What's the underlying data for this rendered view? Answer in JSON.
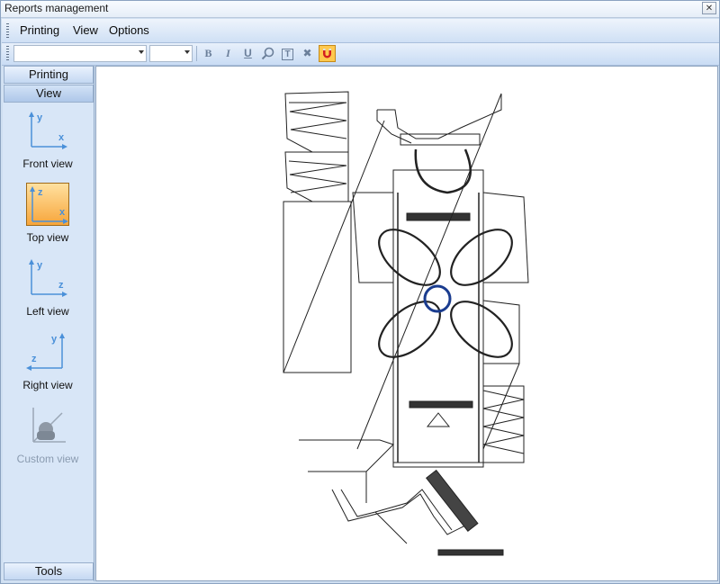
{
  "window": {
    "title": "Reports management",
    "close_glyph": "✕"
  },
  "menu": {
    "items": [
      "Printing",
      "View",
      "Options"
    ]
  },
  "toolbar": {
    "font_combo_value": "",
    "size_combo_value": "",
    "buttons": [
      {
        "icon": "bold-icon",
        "glyph": "B"
      },
      {
        "icon": "italic-icon",
        "glyph": "I"
      },
      {
        "icon": "underline-icon",
        "glyph": "U"
      },
      {
        "icon": "zoom-icon",
        "glyph": ""
      },
      {
        "icon": "text-box-icon",
        "glyph": "T"
      },
      {
        "icon": "delete-icon",
        "glyph": "✖"
      },
      {
        "icon": "magnet-icon",
        "glyph": ""
      }
    ]
  },
  "sidebar": {
    "sections": [
      {
        "label": "Printing",
        "selected": false
      },
      {
        "label": "View",
        "selected": true
      }
    ],
    "views": [
      {
        "label": "Front view",
        "active": false,
        "enabled": true,
        "axes": [
          "y",
          "x"
        ]
      },
      {
        "label": "Top view",
        "active": true,
        "enabled": true,
        "axes": [
          "z",
          "x"
        ]
      },
      {
        "label": "Left view",
        "active": false,
        "enabled": true,
        "axes": [
          "y",
          "z"
        ]
      },
      {
        "label": "Right view",
        "active": false,
        "enabled": true,
        "axes": [
          "y",
          "z"
        ]
      },
      {
        "label": "Custom view",
        "active": false,
        "enabled": false,
        "axes": []
      }
    ],
    "footer": {
      "label": "Tools"
    }
  },
  "colors": {
    "accent_active": "#f7a53a",
    "axis_blue": "#4a90d9",
    "panel_blue": "#d8e6f7"
  }
}
